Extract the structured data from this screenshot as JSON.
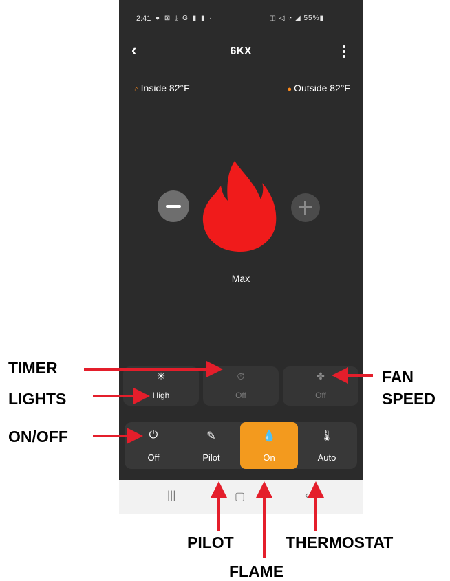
{
  "status_bar": {
    "time": "2:41",
    "icons": "● ⊠ ⤓ G ▮ ▮ ·",
    "right": "◫ ◁ ◔ ◢ 55%▮"
  },
  "header": {
    "title": "6KX",
    "back_icon": "chevron-left-icon",
    "menu_icon": "more-vertical-icon"
  },
  "temps": {
    "inside": "Inside  82°F",
    "outside": "Outside  82°F"
  },
  "flame": {
    "level_label": "Max",
    "color": "#f01b1b"
  },
  "settings_row": [
    {
      "id": "lights",
      "label": "High",
      "icon": "☀",
      "active": true
    },
    {
      "id": "timer",
      "label": "Off",
      "icon": "⏱",
      "active": false
    },
    {
      "id": "fan",
      "label": "Off",
      "icon": "✤",
      "active": false
    }
  ],
  "mode_row": [
    {
      "id": "power",
      "label": "Off",
      "icon": "⏻"
    },
    {
      "id": "pilot",
      "label": "Pilot",
      "icon": "✎"
    },
    {
      "id": "flame",
      "label": "On",
      "icon": "💧"
    },
    {
      "id": "thermostat",
      "label": "Auto",
      "icon": "🌡"
    }
  ],
  "nav": {
    "recent": "|||",
    "home": "▢",
    "back": "‹"
  },
  "annotations": {
    "timer": "TIMER",
    "lights": "LIGHTS",
    "onoff": "ON/OFF",
    "fan_speed_1": "FAN",
    "fan_speed_2": "SPEED",
    "pilot": "PILOT",
    "flame": "FLAME",
    "thermostat": "THERMOSTAT"
  },
  "colors": {
    "accent": "#f39a1e",
    "annotation_arrow": "#e41e2b",
    "background": "#2b2b2b"
  }
}
